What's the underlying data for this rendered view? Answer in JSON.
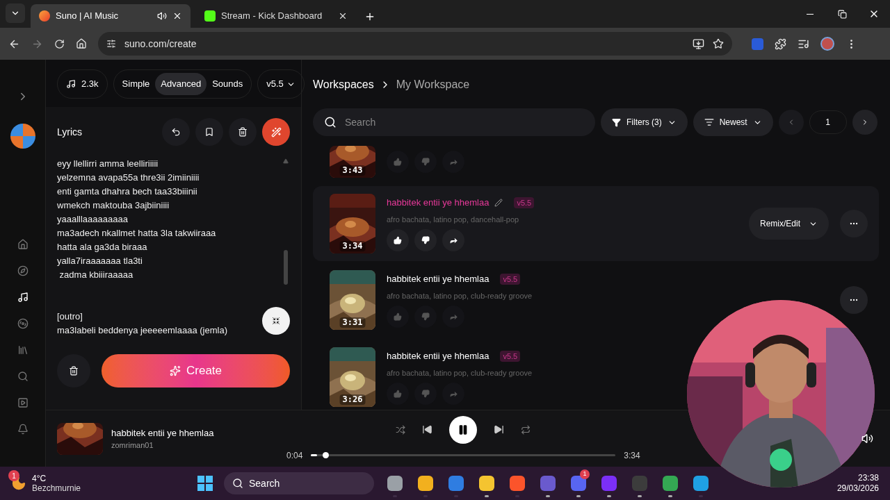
{
  "browser": {
    "tabs": [
      {
        "title": "Suno | AI Music",
        "selected": true,
        "audio": true,
        "kind": "suno"
      },
      {
        "title": "Stream - Kick Dashboard",
        "selected": false,
        "audio": false,
        "kind": "kick"
      }
    ],
    "url": "suno.com/create"
  },
  "sidebar": {
    "items": [
      {
        "kind": "home",
        "selected": false
      },
      {
        "kind": "explore",
        "selected": false
      },
      {
        "kind": "create",
        "selected": true
      },
      {
        "kind": "studio",
        "selected": false
      },
      {
        "kind": "library",
        "selected": false
      },
      {
        "kind": "search",
        "selected": false
      },
      {
        "kind": "video",
        "selected": false
      },
      {
        "kind": "bell",
        "selected": false
      }
    ]
  },
  "create_panel": {
    "credits": "2.3k",
    "modes": [
      {
        "label": "Simple",
        "selected": false
      },
      {
        "label": "Advanced",
        "selected": true
      },
      {
        "label": "Sounds",
        "selected": false
      }
    ],
    "model": "v5.5",
    "lyrics_label": "Lyrics",
    "lyrics": [
      [
        "eyy llellirri amma leelliriiiii",
        "yelzemna avapa55a thre3ii 2imiiniiii",
        "enti gamta dhahra bech taa33biiinii",
        "wmekch maktouba 3ajbiiniiii",
        "yaaalllaaaaaaaaa",
        "ma3adech nkallmet hatta 3la takwiiraaa",
        "hatta ala ga3da biraaa",
        "yalla7iraaaaaaa tla3ti",
        " zadma kbiiiraaaaa"
      ],
      [
        "[outro]",
        "ma3labeli beddenya jeeeeemlaaaa (jemla)"
      ]
    ],
    "create_button": "Create"
  },
  "workspace": {
    "breadcrumb": [
      "Workspaces",
      "My Workspace"
    ],
    "search_placeholder": "Search",
    "filters": "Filters (3)",
    "sort": "Newest",
    "page": "1",
    "songs": [
      {
        "duration": "3:43",
        "playing": false,
        "cut": true
      },
      {
        "title": "habbitek entii ye hhemlaa",
        "version": "v5.5",
        "tags": "afro bachata, latino pop, dancehall-pop",
        "duration": "3:34",
        "playing": true,
        "action": "Remix/Edit",
        "more": true
      },
      {
        "title": "habbitek entii ye hhemlaa",
        "version": "v5.5",
        "tags": "afro bachata, latino pop, club-ready groove",
        "duration": "3:31",
        "playing": false,
        "more": true
      },
      {
        "title": "habbitek entii ye hhemlaa",
        "version": "v5.5",
        "tags": "afro bachata, latino pop, club-ready groove",
        "duration": "3:26",
        "playing": false
      }
    ]
  },
  "player": {
    "title": "habbitek entii ye hhemlaa",
    "artist": "zomriman01",
    "elapsed": "0:04",
    "total": "3:34",
    "level": 0.02,
    "playing": true
  },
  "taskbar": {
    "weather": {
      "temp": "4°C",
      "place": "Bezchmurnie",
      "badge": "1"
    },
    "search": "Search",
    "apps": [
      {
        "color": "#9aa0a6",
        "running": false
      },
      {
        "color": "#f2b01e",
        "running": false
      },
      {
        "color": "#2f7de1",
        "running": false
      },
      {
        "color": "#f4c430",
        "running": true
      },
      {
        "color": "#fb542b",
        "running": false
      },
      {
        "color": "#6a5acd",
        "running": true
      },
      {
        "color": "#5865f2",
        "running": true,
        "badge": "1"
      },
      {
        "color": "#7b2ff7",
        "running": true
      },
      {
        "color": "#3c3c3c",
        "running": true
      },
      {
        "color": "#34a853",
        "running": true
      },
      {
        "color": "#1fa0e3",
        "running": false
      }
    ],
    "time": "23:38",
    "date": "29/03/2026"
  }
}
